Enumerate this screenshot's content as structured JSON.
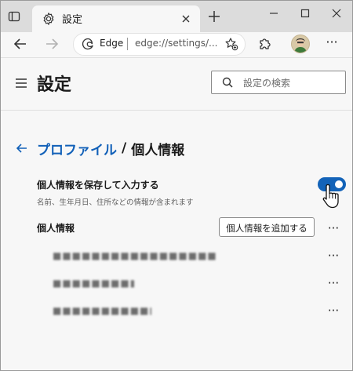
{
  "browser": {
    "tab": {
      "title": "設定"
    },
    "address": {
      "site_label": "Edge",
      "url": "edge://settings/..."
    }
  },
  "settings": {
    "title": "設定",
    "search": {
      "placeholder": "設定の検索"
    },
    "breadcrumb": {
      "parent": "プロファイル",
      "separator": "/",
      "current": "個人情報"
    },
    "save_personal_info": {
      "label": "個人情報を保存して入力する",
      "description": "名前、生年月日、住所などの情報が含まれます",
      "enabled": true
    },
    "personal_info": {
      "label": "個人情報",
      "add_button": "個人情報を追加する",
      "more_label": "···",
      "entries": [
        {
          "text": "■■■■■■■■■■■■■■■■■■"
        },
        {
          "text": "■■■■■■■■■"
        },
        {
          "text": "■■■■■■■■■■■"
        }
      ]
    }
  },
  "colors": {
    "accent": "#1363b8",
    "link": "#1160b8",
    "titlebar": "#dcdcdc",
    "background": "#f7f7f7"
  },
  "icons": {
    "tab_actions": "tab-actions-icon",
    "tab": "gear-icon",
    "close": "close-icon",
    "new_tab": "plus-icon",
    "back": "back-arrow-icon",
    "forward": "forward-arrow-icon",
    "edge": "edge-logo-icon",
    "favorite": "add-favorite-icon",
    "extensions": "puzzle-icon",
    "menu": "hamburger-icon",
    "search": "search-icon"
  }
}
